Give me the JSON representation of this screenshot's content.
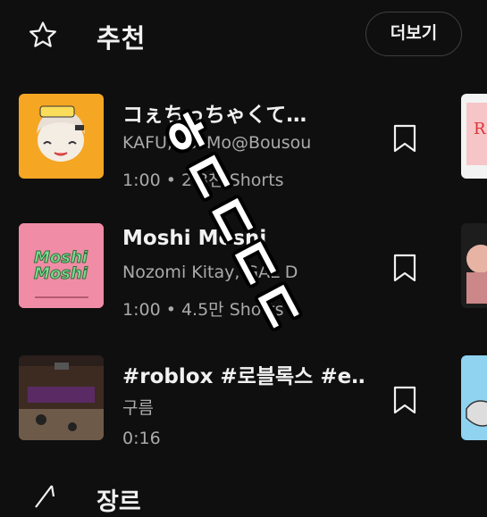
{
  "header": {
    "title": "추천",
    "more_label": "더보기"
  },
  "items": [
    {
      "title": "コぇちっちゃくて…",
      "artist": "KAFU, cosMo@Bousou",
      "meta": "1:00 • 2.3천 Shorts",
      "thumb_text": ""
    },
    {
      "title": "Moshi Moshi",
      "artist": "Nozomi Kitay, GAL D",
      "meta": "1:00 • 4.5만 Shorts",
      "thumb_text": "Moshi Moshi"
    },
    {
      "title": "#roblox #로블록스 #e…",
      "artist": "구름",
      "meta": "0:16",
      "thumb_text": ""
    }
  ],
  "footer": {
    "title": "장르"
  },
  "overlay_text": "ㅎㄷㄷㄷㄷ",
  "colors": {
    "background": "#0f0f0f",
    "text_primary": "#f1f1f1",
    "text_secondary": "#aaaaaa",
    "thumb1": "#f5a623",
    "thumb2": "#f08ca6"
  }
}
